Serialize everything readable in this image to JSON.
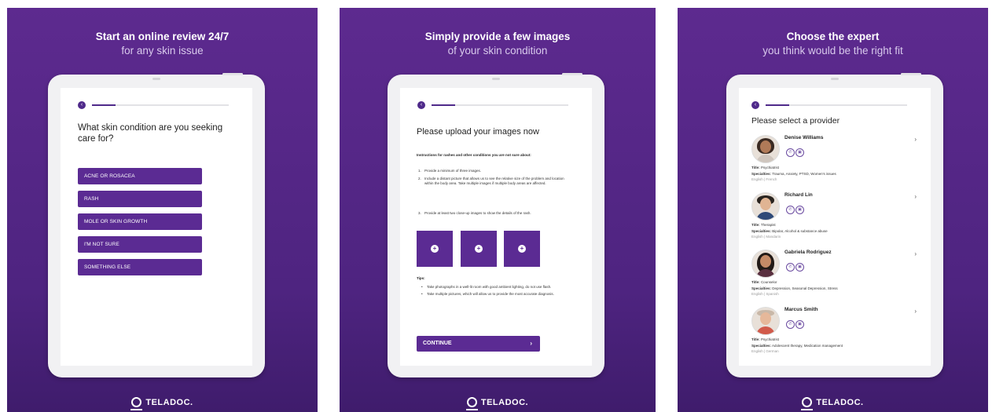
{
  "panel1": {
    "headline_bold": "Start an online review 24/7",
    "headline_sub": "for any skin issue",
    "question": "What skin condition are you seeking care for?",
    "options": [
      "ACNE OR ROSACEA",
      "RASH",
      "MOLE OR SKIN GROWTH",
      "I'M NOT SURE",
      "SOMETHING ELSE"
    ],
    "back_glyph": "‹"
  },
  "panel2": {
    "headline_bold": "Simply provide a few images",
    "headline_sub": "of your skin condition",
    "title": "Please upload your images now",
    "intro": "Instructions for rashes and other conditions you are not sure about:",
    "steps": [
      {
        "num": "1.",
        "text": "Provide a minimum of three images."
      },
      {
        "num": "2.",
        "text": "Include a distant picture that allows us to see the relative size of the problem and location within the body area. Take multiple images if multiple body areas are affected."
      },
      {
        "num": "3.",
        "text": "Provide at least two close-up images to show the details of the rash."
      }
    ],
    "tips_title": "Tips:",
    "tips": [
      "Take photographs in a well-lit room with good ambient lighting, do not use flash.",
      "Take multiple pictures, which will allow us to provide the most accurate diagnosis."
    ],
    "continue_label": "CONTINUE",
    "continue_chev": "›",
    "plus_glyph": "+"
  },
  "panel3": {
    "headline_bold": "Choose the expert",
    "headline_sub": "you think would be the right fit",
    "title": "Please select a provider",
    "providers": [
      {
        "name": "Denise Williams",
        "title": "Psychiatrist",
        "specialties": "Trauma, Anxiety, PTSD, Women's issues",
        "languages": "English | French"
      },
      {
        "name": "Richard Lin",
        "title": "Therapist",
        "specialties": "Bipolar, Alcohol & substance abuse",
        "languages": "English | Mandarin"
      },
      {
        "name": "Gabriela Rodriguez",
        "title": "Counselor",
        "specialties": "Depression, Seasonal Depression, Stress",
        "languages": "English | Spanish"
      },
      {
        "name": "Marcus Smith",
        "title": "Psychiatrist",
        "specialties": "Adolescent therapy, Medication management",
        "languages": "English | German"
      }
    ],
    "title_label": "Title:",
    "specialties_label": "Specialties:",
    "phone_glyph": "✆",
    "video_glyph": "▣",
    "chev": "›"
  },
  "brand": "TELADOC."
}
